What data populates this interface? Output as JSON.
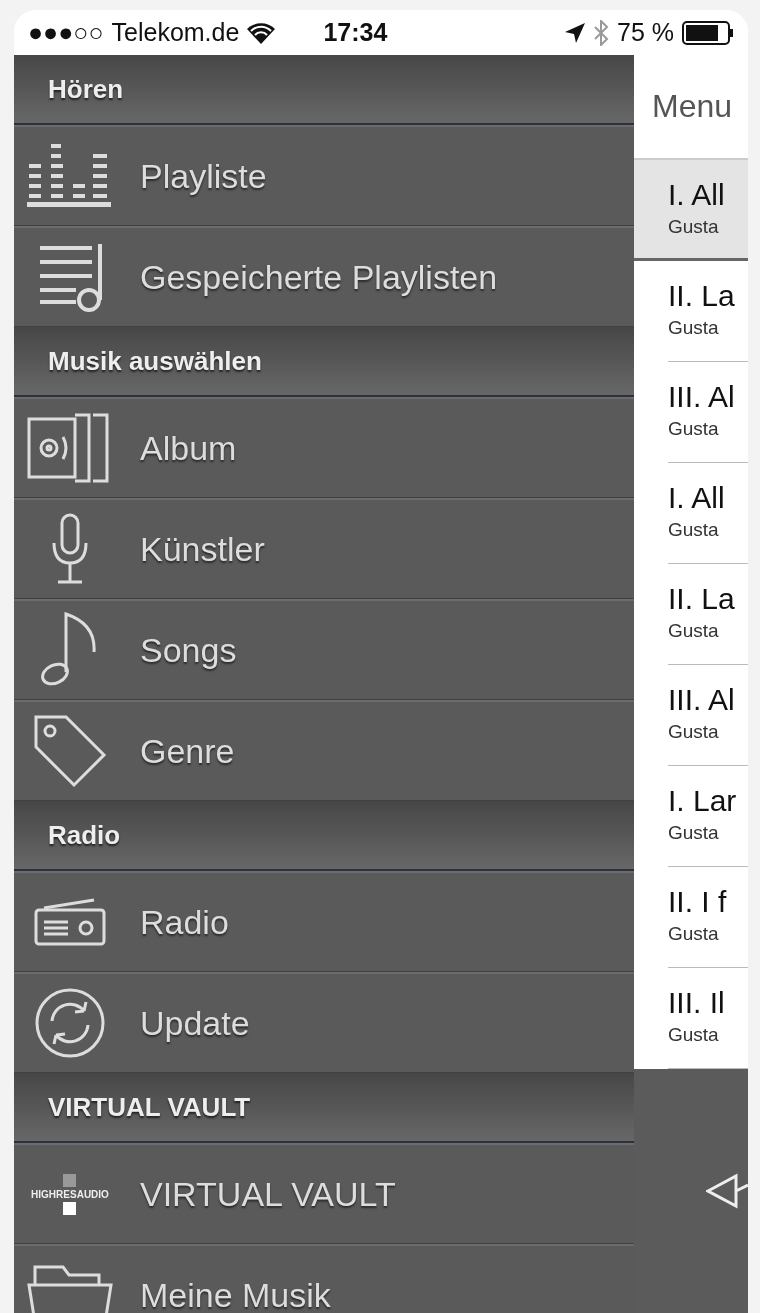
{
  "status_bar": {
    "signal": "●●●○○",
    "carrier": "Telekom.de",
    "time": "17:34",
    "battery": "75 %"
  },
  "menu": {
    "sections": [
      {
        "title": "Hören",
        "items": [
          {
            "kind": "equalizer",
            "label": "Playliste"
          },
          {
            "kind": "playlist",
            "label": "Gespeicherte Playlisten"
          }
        ]
      },
      {
        "title": "Musik auswählen",
        "items": [
          {
            "kind": "album",
            "label": "Album"
          },
          {
            "kind": "microphone",
            "label": "Künstler"
          },
          {
            "kind": "note",
            "label": "Songs"
          },
          {
            "kind": "tag",
            "label": "Genre"
          }
        ]
      },
      {
        "title": "Radio",
        "items": [
          {
            "kind": "radio",
            "label": "Radio"
          },
          {
            "kind": "refresh",
            "label": "Update"
          }
        ]
      },
      {
        "title": "VIRTUAL VAULT",
        "items": [
          {
            "kind": "logo",
            "label": "VIRTUAL VAULT",
            "logo_text": "HIGHRESAUDIO"
          },
          {
            "kind": "folder",
            "label": "Meine Musik"
          }
        ]
      }
    ]
  },
  "track_panel": {
    "title": "Menu",
    "rows": [
      {
        "title": "I. All",
        "subtitle": "Gusta",
        "selected": true
      },
      {
        "title": "II. La",
        "subtitle": "Gusta",
        "selected": false
      },
      {
        "title": "III. Al",
        "subtitle": "Gusta",
        "selected": false
      },
      {
        "title": "I. All",
        "subtitle": "Gusta",
        "selected": false
      },
      {
        "title": "II. La",
        "subtitle": "Gusta",
        "selected": false
      },
      {
        "title": "III. Al",
        "subtitle": "Gusta",
        "selected": false
      },
      {
        "title": "I. Lar",
        "subtitle": "Gusta",
        "selected": false
      },
      {
        "title": "II. I f",
        "subtitle": "Gusta",
        "selected": false
      },
      {
        "title": "III. Il",
        "subtitle": "Gusta",
        "selected": false
      }
    ]
  }
}
